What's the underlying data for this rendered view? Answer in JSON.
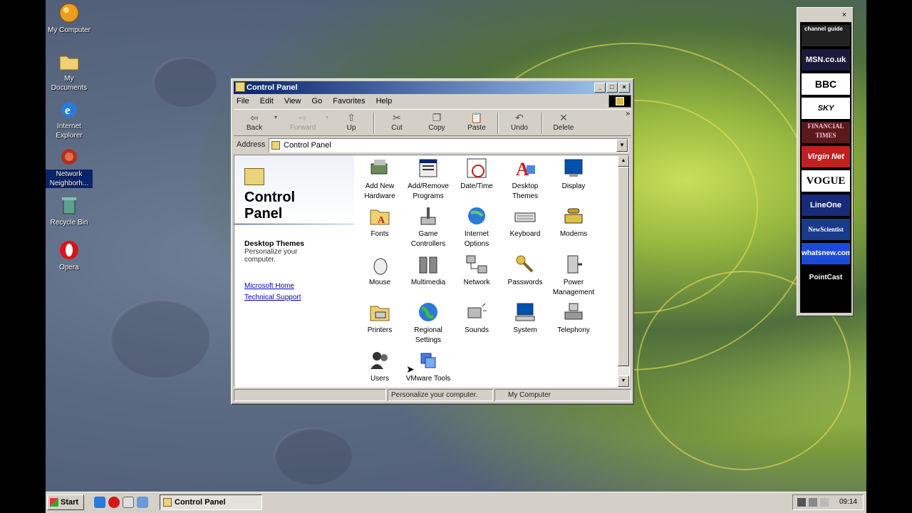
{
  "desktop": {
    "icons": [
      {
        "label": "My Computer",
        "icon": "my-computer-icon"
      },
      {
        "label": "My Documents",
        "icon": "my-documents-icon"
      },
      {
        "label": "Internet Explorer",
        "icon": "internet-explorer-icon"
      },
      {
        "label": "Network Neighborh...",
        "icon": "network-neighborhood-icon"
      },
      {
        "label": "Recycle Bin",
        "icon": "recycle-bin-icon"
      },
      {
        "label": "Opera",
        "icon": "opera-icon"
      }
    ]
  },
  "window": {
    "title": "Control Panel",
    "menu": [
      "File",
      "Edit",
      "View",
      "Go",
      "Favorites",
      "Help"
    ],
    "toolbar": {
      "back": "Back",
      "forward": "Forward",
      "up": "Up",
      "cut": "Cut",
      "copy": "Copy",
      "paste": "Paste",
      "undo": "Undo",
      "delete": "Delete"
    },
    "address": {
      "label": "Address",
      "value": "Control Panel"
    },
    "left_pane": {
      "heading": "Control Panel",
      "selected_title": "Desktop Themes",
      "selected_desc": "Personalize your computer.",
      "link_home": "Microsoft Home",
      "link_support": "Technical Support"
    },
    "items": [
      {
        "label": "Add New Hardware",
        "icon": "add-hardware-icon"
      },
      {
        "label": "Add/Remove Programs",
        "icon": "add-remove-programs-icon"
      },
      {
        "label": "Date/Time",
        "icon": "date-time-icon"
      },
      {
        "label": "Desktop Themes",
        "icon": "desktop-themes-icon"
      },
      {
        "label": "Display",
        "icon": "display-icon"
      },
      {
        "label": "Fonts",
        "icon": "fonts-icon"
      },
      {
        "label": "Game Controllers",
        "icon": "game-controllers-icon"
      },
      {
        "label": "Internet Options",
        "icon": "internet-options-icon"
      },
      {
        "label": "Keyboard",
        "icon": "keyboard-icon"
      },
      {
        "label": "Modems",
        "icon": "modems-icon"
      },
      {
        "label": "Mouse",
        "icon": "mouse-icon"
      },
      {
        "label": "Multimedia",
        "icon": "multimedia-icon"
      },
      {
        "label": "Network",
        "icon": "network-icon"
      },
      {
        "label": "Passwords",
        "icon": "passwords-icon"
      },
      {
        "label": "Power Management",
        "icon": "power-management-icon"
      },
      {
        "label": "Printers",
        "icon": "printers-icon"
      },
      {
        "label": "Regional Settings",
        "icon": "regional-settings-icon"
      },
      {
        "label": "Sounds",
        "icon": "sounds-icon"
      },
      {
        "label": "System",
        "icon": "system-icon"
      },
      {
        "label": "Telephony",
        "icon": "telephony-icon"
      },
      {
        "label": "Users",
        "icon": "users-icon"
      },
      {
        "label": "VMware Tools",
        "icon": "vmware-tools-icon"
      }
    ],
    "status": {
      "message": "Personalize your computer.",
      "zone": "My Computer"
    }
  },
  "channel_bar": {
    "channels": [
      "channel guide",
      "MSN.co.uk",
      "BBC",
      "SKY",
      "FINANCIAL TIMES",
      "Virgin Net",
      "VOGUE",
      "LineOne",
      "NewScientist",
      "whatsnew.com",
      "PointCast"
    ]
  },
  "taskbar": {
    "start": "Start",
    "task": "Control Panel",
    "clock": "09:14"
  }
}
